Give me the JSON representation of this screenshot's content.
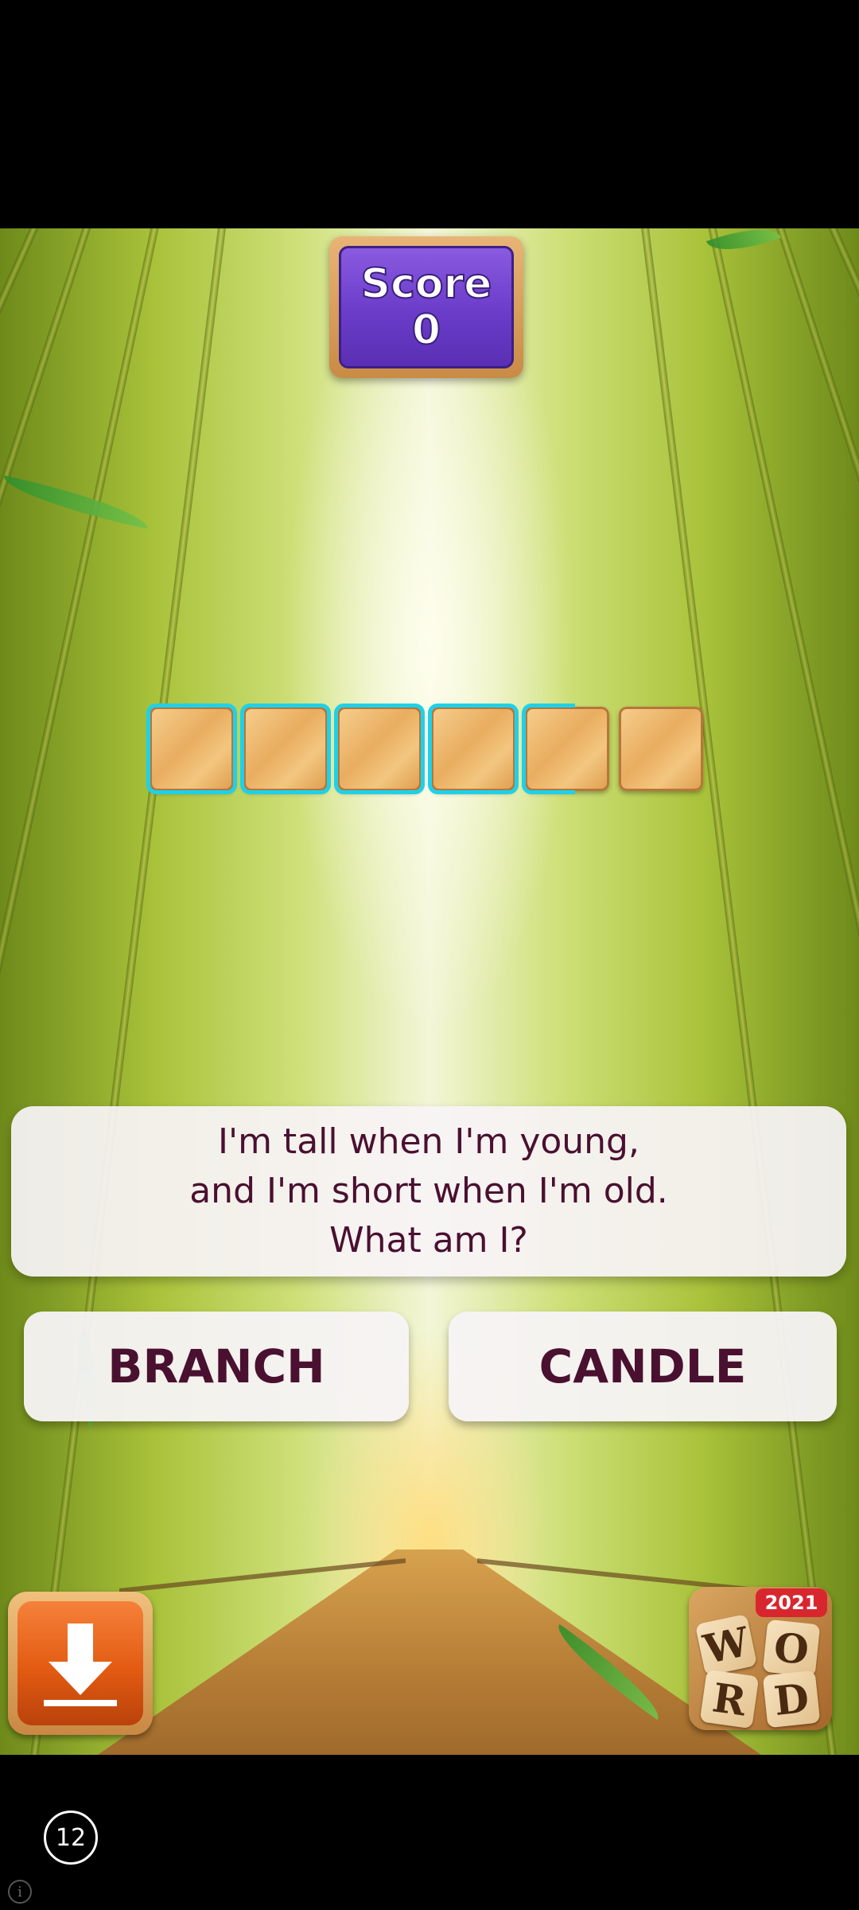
{
  "score": {
    "label": "Score",
    "value": "0"
  },
  "answer_tiles": {
    "count": 6,
    "selected_count": 4.5
  },
  "question": {
    "lines": [
      "I'm tall when I'm young,",
      "and I'm short when I'm old.",
      "What am I?"
    ]
  },
  "answers": [
    {
      "label": "BRANCH"
    },
    {
      "label": "CANDLE"
    }
  ],
  "download": {
    "icon": "download-arrow-icon"
  },
  "logo": {
    "year": "2021",
    "letters": [
      "W",
      "O",
      "R",
      "D"
    ]
  },
  "badge": {
    "value": "12"
  },
  "info": {
    "symbol": "i"
  },
  "colors": {
    "score_purple": "#6a3cc9",
    "tile_highlight": "#1ed1e9",
    "text_maroon": "#4a1030",
    "download_orange": "#e35b12",
    "logo_badge_red": "#d8262f"
  }
}
